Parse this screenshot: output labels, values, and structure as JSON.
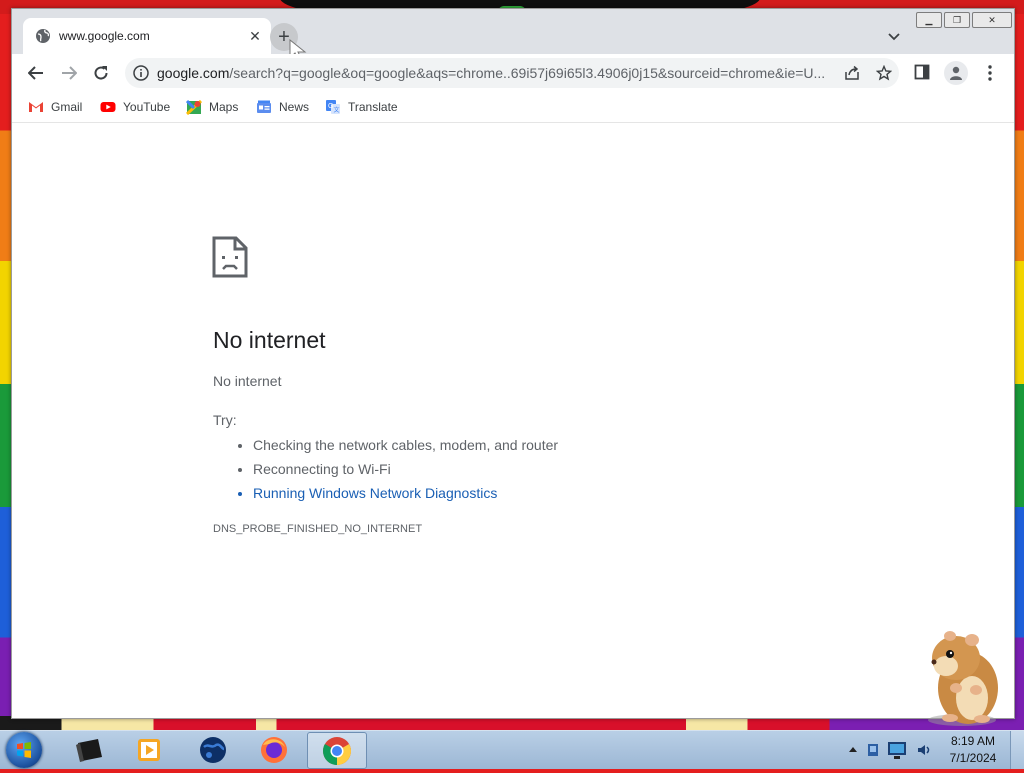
{
  "browser": {
    "tab": {
      "title": "www.google.com",
      "close_label": "✕"
    },
    "new_tab_label": "+",
    "address_bar": {
      "host": "google.com",
      "path": "/search?q=google&oq=google&aqs=chrome..69i57j69i65l3.4906j0j15&sourceid=chrome&ie=U..."
    },
    "bookmarks": [
      {
        "label": "Gmail",
        "icon": "gmail-icon"
      },
      {
        "label": "YouTube",
        "icon": "youtube-icon"
      },
      {
        "label": "Maps",
        "icon": "maps-icon"
      },
      {
        "label": "News",
        "icon": "news-icon"
      },
      {
        "label": "Translate",
        "icon": "translate-icon"
      }
    ]
  },
  "error_page": {
    "title": "No internet",
    "subtitle": "No internet",
    "try_label": "Try:",
    "suggestions": [
      "Checking the network cables, modem, and router",
      "Reconnecting to Wi-Fi",
      "Running Windows Network Diagnostics"
    ],
    "error_code": "DNS_PROBE_FINISHED_NO_INTERNET"
  },
  "taskbar": {
    "apps": [
      "terminal-app",
      "media-player-app",
      "globe-app",
      "firefox-app",
      "chrome-app"
    ],
    "clock": {
      "time": "8:19 AM",
      "date": "7/1/2024"
    }
  },
  "colors": {
    "link": "#1a5fb4",
    "tab_strip": "#dee1e6",
    "omnibox": "#f1f3f4"
  }
}
